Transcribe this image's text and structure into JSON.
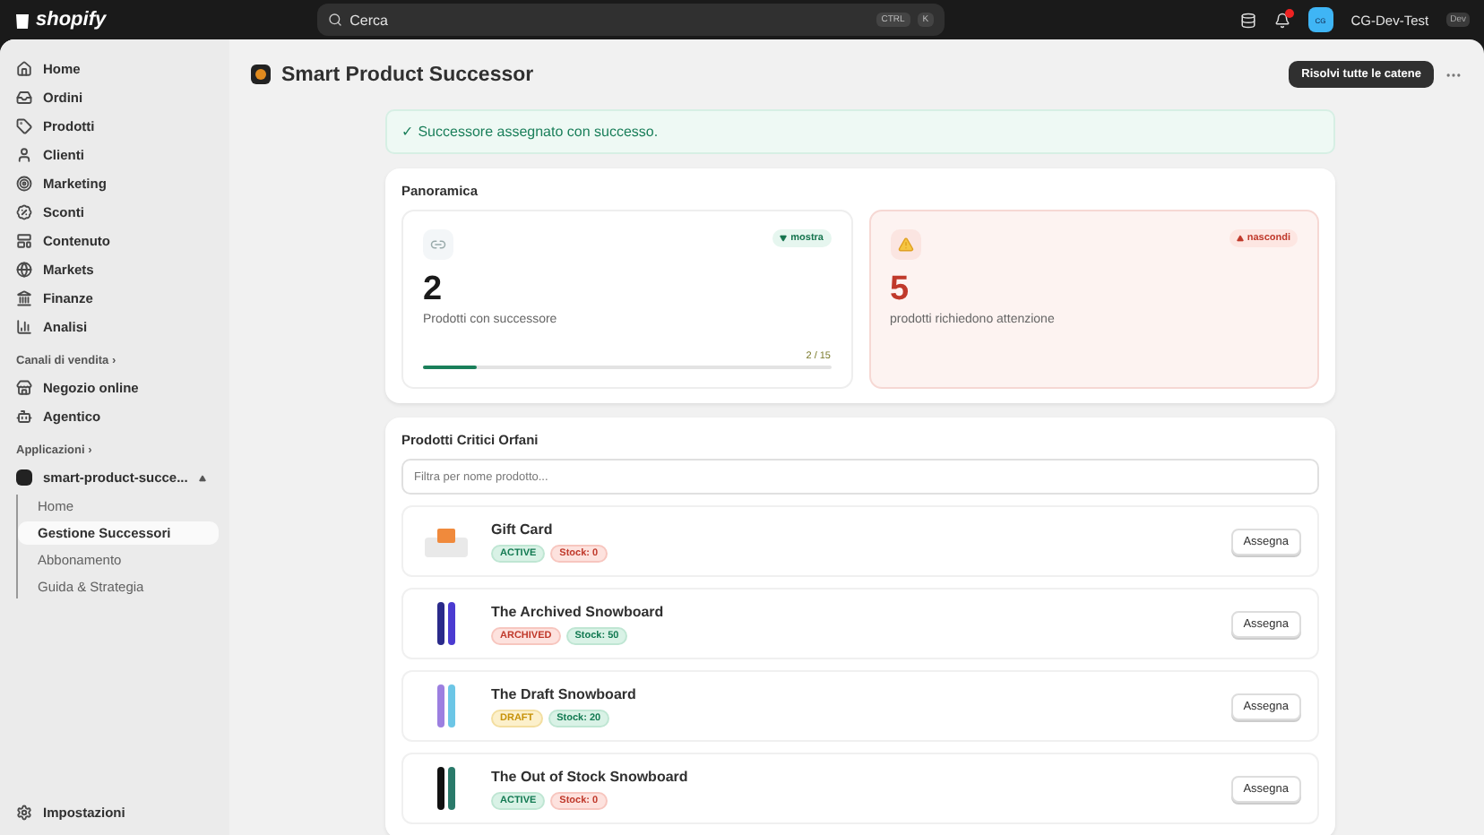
{
  "topbar": {
    "brand": "shopify",
    "search": {
      "placeholder": "Cerca",
      "keys": [
        "CTRL",
        "K"
      ]
    },
    "store": {
      "initials": "CG",
      "name": "CG-Dev-Test",
      "badge": "Dev"
    }
  },
  "sidebar": {
    "items": [
      {
        "label": "Home",
        "selected": false
      },
      {
        "label": "Ordini",
        "selected": false
      },
      {
        "label": "Prodotti",
        "selected": false
      },
      {
        "label": "Clienti",
        "selected": false
      },
      {
        "label": "Marketing",
        "selected": false
      },
      {
        "label": "Sconti",
        "selected": false
      },
      {
        "label": "Contenuto",
        "selected": false
      },
      {
        "label": "Markets",
        "selected": false
      },
      {
        "label": "Finanze",
        "selected": false
      },
      {
        "label": "Analisi",
        "selected": false
      }
    ],
    "sales_channels": {
      "title": "Canali di vendita ›",
      "items": [
        {
          "label": "Negozio online",
          "selected": false
        },
        {
          "label": "Agentico",
          "selected": false
        }
      ]
    },
    "apps": {
      "title": "Applicazioni ›",
      "items": [
        {
          "label": "smart-product-succe...",
          "expanded": true,
          "children": [
            {
              "label": "Home",
              "selected": false
            },
            {
              "label": "Gestione Successori",
              "selected": true
            },
            {
              "label": "Abbonamento",
              "selected": false
            },
            {
              "label": "Guida & Strategia",
              "selected": false
            }
          ]
        }
      ]
    },
    "settings": {
      "label": "Impostazioni"
    }
  },
  "page": {
    "title": "Smart Product Successor",
    "primary_action": "Risolvi tutte le catene"
  },
  "banner": {
    "text": "✓ Successore assegnato con successo."
  },
  "overview": {
    "title": "Panoramica",
    "cards": [
      {
        "kind": "ok",
        "value": "2",
        "label": "Prodotti con successore",
        "toggle": "mostra",
        "expanded": false,
        "level": 0.133,
        "reading": "2 / 15"
      },
      {
        "kind": "alert",
        "value": "5",
        "label": "prodotti richiedono attenzione",
        "toggle": "nascondi",
        "expanded": true
      }
    ]
  },
  "orphans": {
    "title": "Prodotti Critici Orfani",
    "filter": {
      "placeholder": "Filtra per nome prodotto..."
    },
    "products": [
      {
        "name": "Gift Card",
        "tags": [
          {
            "label": "ACTIVE",
            "kind": "success"
          },
          {
            "label": "Stock: 0",
            "kind": "critical"
          }
        ],
        "action": "Assegna"
      },
      {
        "name": "The Archived Snowboard",
        "tags": [
          {
            "label": "ARCHIVED",
            "kind": "critical"
          },
          {
            "label": "Stock: 50",
            "kind": "success"
          }
        ],
        "action": "Assegna"
      },
      {
        "name": "The Draft Snowboard",
        "tags": [
          {
            "label": "DRAFT",
            "kind": "warning"
          },
          {
            "label": "Stock: 20",
            "kind": "success"
          }
        ],
        "action": "Assegna"
      },
      {
        "name": "The Out of Stock Snowboard",
        "tags": [
          {
            "label": "ACTIVE",
            "kind": "success"
          },
          {
            "label": "Stock: 0",
            "kind": "critical"
          }
        ],
        "action": "Assegna"
      }
    ]
  }
}
